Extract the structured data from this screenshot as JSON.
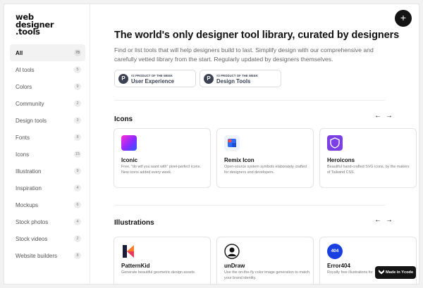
{
  "logo": {
    "line1": "web",
    "line2": "designer",
    "line3": ".tools"
  },
  "sidebar": {
    "items": [
      {
        "label": "All",
        "count": "78",
        "active": true
      },
      {
        "label": "AI tools",
        "count": "5"
      },
      {
        "label": "Colors",
        "count": "9"
      },
      {
        "label": "Community",
        "count": "2"
      },
      {
        "label": "Design tools",
        "count": "3"
      },
      {
        "label": "Fonts",
        "count": "8"
      },
      {
        "label": "Icons",
        "count": "15"
      },
      {
        "label": "Illustration",
        "count": "9"
      },
      {
        "label": "Inspiration",
        "count": "4"
      },
      {
        "label": "Mockups",
        "count": "6"
      },
      {
        "label": "Stock photos",
        "count": "4"
      },
      {
        "label": "Stock videos",
        "count": "2"
      },
      {
        "label": "Website builders",
        "count": "8"
      }
    ]
  },
  "header": {
    "plus_label": "+"
  },
  "hero": {
    "title": "The world's only designer tool library, curated by designers",
    "subtitle": "Find or list tools that will help designers build to last. Simplify design with our comprehensive and carefully vetted library from the start. Regularly updated by designers themselves."
  },
  "badges": [
    {
      "icon_letter": "P",
      "small": "#2 PRODUCT OF THE WEEK",
      "big": "User Experience"
    },
    {
      "icon_letter": "P",
      "small": "#3 PRODUCT OF THE WEEK",
      "big": "Design Tools"
    }
  ],
  "sections": [
    {
      "title": "Icons",
      "prev": "←",
      "next": "→",
      "cards": [
        {
          "name": "Iconic",
          "desc": "Free, \"do wtf you want with\" pixel-perfect icons. New icons added every week.",
          "icon": "iconic-logo-icon"
        },
        {
          "name": "Remix Icon",
          "desc": "Open-source system symbols elaborately crafted for designers and developers.",
          "icon": "remix-logo-icon"
        },
        {
          "name": "Heroicons",
          "desc": "Beautiful hand-crafted SVG icons, by the makers of Tailwind CSS.",
          "icon": "heroicons-logo-icon"
        }
      ]
    },
    {
      "title": "Illustrations",
      "prev": "←",
      "next": "→",
      "cards": [
        {
          "name": "PatternKid",
          "desc": "Generate beautiful geometric design assets.",
          "icon": "patternkid-logo-icon"
        },
        {
          "name": "unDraw",
          "desc": "Use the on-the-fly color image generation to match your brand identity.",
          "icon": "undraw-logo-icon"
        },
        {
          "name": "Error404",
          "desc": "Royalty free illustrations for",
          "icon": "error404-logo-icon",
          "icon_text": "404"
        }
      ]
    }
  ],
  "ycode_badge": {
    "label": "Made in Ycode"
  },
  "colors": {
    "accent_dark": "#141414",
    "badge_ink": "#3c4253",
    "heroicons_purple": "#7b3fe4",
    "error404_blue": "#1a3fe0"
  }
}
